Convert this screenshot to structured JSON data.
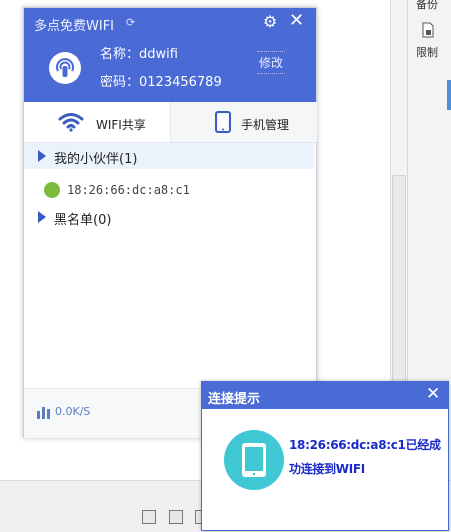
{
  "background_app": {
    "side_items": [
      "备份",
      "限制"
    ]
  },
  "window": {
    "title": "多点免费WIFI",
    "wifi": {
      "name_label": "名称：",
      "name_value": "ddwifi",
      "password_label": "密码：",
      "password_value": "0123456789",
      "edit_label": "修改"
    },
    "tabs": [
      {
        "label": "WIFI共享",
        "active": true
      },
      {
        "label": "手机管理",
        "active": false
      }
    ],
    "groups": {
      "friends_label": "我的小伙伴(1)",
      "blacklist_label": "黑名单(0)",
      "devices": [
        {
          "mac": "18:26:66:dc:a8:c1",
          "icon": "android-icon"
        }
      ]
    },
    "footer": {
      "speed": "0.0K/S"
    }
  },
  "notification": {
    "title": "连接提示",
    "message": "18:26:66:dc:a8:c1已经成功连接到WIFI"
  },
  "colors": {
    "accent": "#4a6ad6",
    "notification_text": "#1a2ac8",
    "device_icon": "#7cbb3e",
    "phone_circle": "#3fc8d4"
  }
}
